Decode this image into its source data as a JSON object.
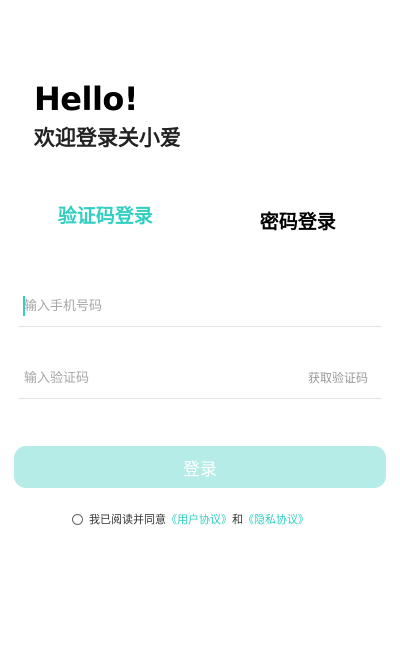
{
  "header": {
    "greeting": "Hello!",
    "welcome": "欢迎登录关小爱"
  },
  "tabs": [
    {
      "label": "验证码登录",
      "active": true
    },
    {
      "label": "密码登录",
      "active": false
    }
  ],
  "form": {
    "phone_placeholder": "输入手机号码",
    "code_placeholder": "输入验证码",
    "get_code_label": "获取验证码",
    "login_label": "登录"
  },
  "agreement": {
    "prefix": "我已阅读并同意",
    "user_agreement": "《用户协议》",
    "conjunction": "和",
    "privacy_agreement": "《隐私协议》"
  },
  "colors": {
    "accent": "#2fcfc2",
    "button_disabled": "#b5ece8"
  }
}
